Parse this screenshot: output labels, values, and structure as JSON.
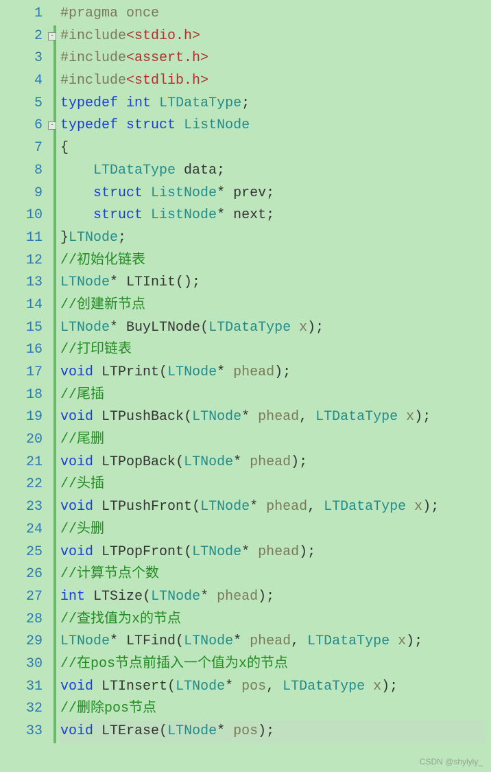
{
  "line_numbers": [
    "1",
    "2",
    "3",
    "4",
    "5",
    "6",
    "7",
    "8",
    "9",
    "10",
    "11",
    "12",
    "13",
    "14",
    "15",
    "16",
    "17",
    "18",
    "19",
    "20",
    "21",
    "22",
    "23",
    "24",
    "25",
    "26",
    "27",
    "28",
    "29",
    "30",
    "31",
    "32",
    "33"
  ],
  "code": {
    "l1": {
      "a": "#pragma once"
    },
    "l2": {
      "a": "#include",
      "b": "<stdio.h>"
    },
    "l3": {
      "a": "#include",
      "b": "<assert.h>"
    },
    "l4": {
      "a": "#include",
      "b": "<stdlib.h>"
    },
    "l5": {
      "a": "typedef",
      "b": "int",
      "c": "LTDataType",
      "d": ";"
    },
    "l6": {
      "a": "typedef",
      "b": "struct",
      "c": "ListNode"
    },
    "l7": {
      "a": "{"
    },
    "l8": {
      "a": "    ",
      "b": "LTDataType",
      "c": " data;"
    },
    "l9": {
      "a": "    ",
      "b": "struct",
      "c": "ListNode",
      "d": "* prev;"
    },
    "l10": {
      "a": "    ",
      "b": "struct",
      "c": "ListNode",
      "d": "* next;"
    },
    "l11": {
      "a": "}",
      "b": "LTNode",
      "c": ";"
    },
    "l12": {
      "a": "//初始化链表"
    },
    "l13": {
      "a": "LTNode",
      "b": "* ",
      "c": "LTInit",
      "d": "();"
    },
    "l14": {
      "a": "//创建新节点"
    },
    "l15": {
      "a": "LTNode",
      "b": "* ",
      "c": "BuyLTNode",
      "d": "(",
      "e": "LTDataType",
      "f": " x",
      "g": ");"
    },
    "l16": {
      "a": "//打印链表"
    },
    "l17": {
      "a": "void",
      "b": "LTPrint",
      "c": "(",
      "d": "LTNode",
      "e": "* ",
      "f": "phead",
      "g": ");"
    },
    "l18": {
      "a": "//尾插"
    },
    "l19": {
      "a": "void",
      "b": "LTPushBack",
      "c": "(",
      "d": "LTNode",
      "e": "* ",
      "f": "phead",
      "g": ", ",
      "h": "LTDataType",
      "i": " x",
      "j": ");"
    },
    "l20": {
      "a": "//尾删"
    },
    "l21": {
      "a": "void",
      "b": "LTPopBack",
      "c": "(",
      "d": "LTNode",
      "e": "* ",
      "f": "phead",
      "g": ");"
    },
    "l22": {
      "a": "//头插"
    },
    "l23": {
      "a": "void",
      "b": "LTPushFront",
      "c": "(",
      "d": "LTNode",
      "e": "* ",
      "f": "phead",
      "g": ", ",
      "h": "LTDataType",
      "i": " x",
      "j": ");"
    },
    "l24": {
      "a": "//头删"
    },
    "l25": {
      "a": "void",
      "b": "LTPopFront",
      "c": "(",
      "d": "LTNode",
      "e": "* ",
      "f": "phead",
      "g": ");"
    },
    "l26": {
      "a": "//计算节点个数"
    },
    "l27": {
      "a": "int",
      "b": "LTSize",
      "c": "(",
      "d": "LTNode",
      "e": "* ",
      "f": "phead",
      "g": ");"
    },
    "l28": {
      "a": "//查找值为x的节点"
    },
    "l29": {
      "a": "LTNode",
      "b": "* ",
      "c": "LTFind",
      "d": "(",
      "e": "LTNode",
      "f": "* ",
      "g": "phead",
      "h": ", ",
      "i": "LTDataType",
      "j": " x",
      "k": ");"
    },
    "l30": {
      "a": "//在pos节点前插入一个值为x的节点"
    },
    "l31": {
      "a": "void",
      "b": "LTInsert",
      "c": "(",
      "d": "LTNode",
      "e": "* ",
      "f": "pos",
      "g": ", ",
      "h": "LTDataType",
      "i": " x",
      "j": ");"
    },
    "l32": {
      "a": "//删除pos节点"
    },
    "l33": {
      "a": "void",
      "b": "LTErase",
      "c": "(",
      "d": "LTNode",
      "e": "* ",
      "f": "pos",
      "g": ");"
    }
  },
  "watermark": "CSDN @shylyly_"
}
